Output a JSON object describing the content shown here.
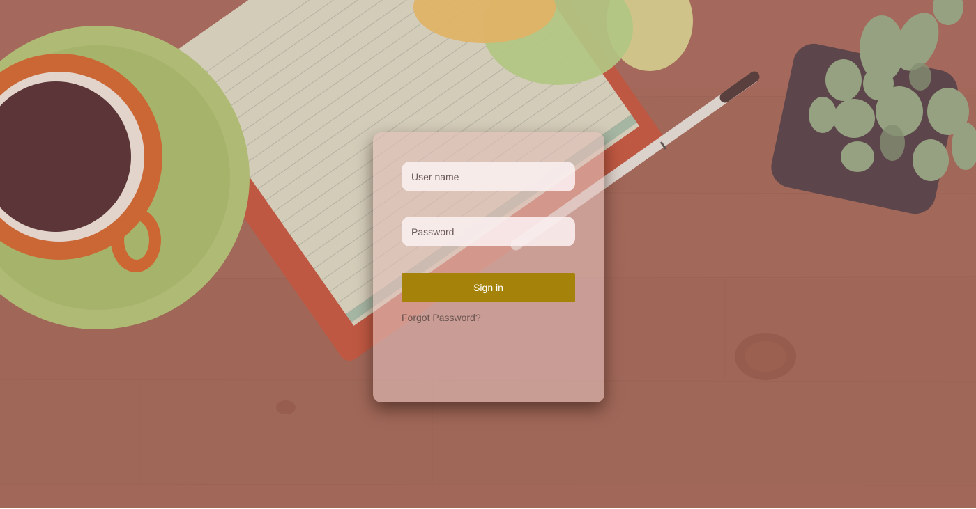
{
  "login": {
    "username_placeholder": "User name",
    "password_placeholder": "Password",
    "signin_label": "Sign in",
    "forgot_label": "Forgot Password?"
  },
  "colors": {
    "signin_button": "#a5830a",
    "card_overlay": "rgba(226,190,185,0.62)",
    "wood_background": "#a36b5c"
  }
}
